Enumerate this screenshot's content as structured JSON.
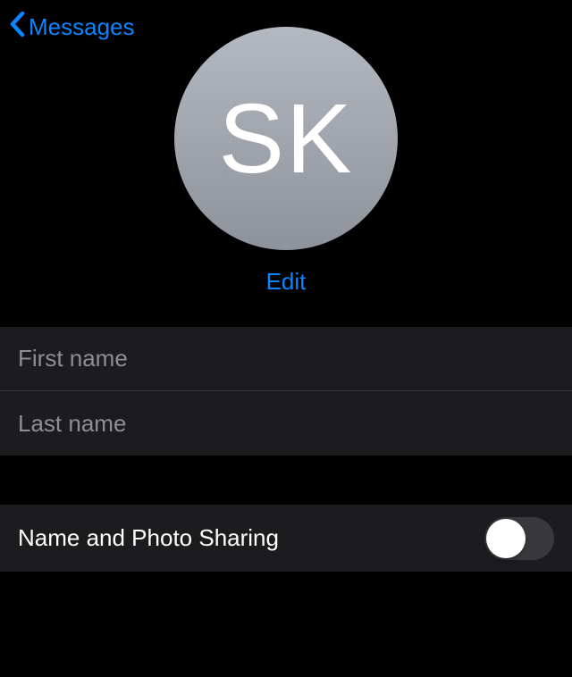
{
  "header": {
    "back_label": "Messages"
  },
  "avatar": {
    "initials": "SK",
    "edit_label": "Edit"
  },
  "form": {
    "first_name": {
      "placeholder": "First name",
      "value": ""
    },
    "last_name": {
      "placeholder": "Last name",
      "value": ""
    }
  },
  "toggle": {
    "label": "Name and Photo Sharing",
    "enabled": false
  }
}
